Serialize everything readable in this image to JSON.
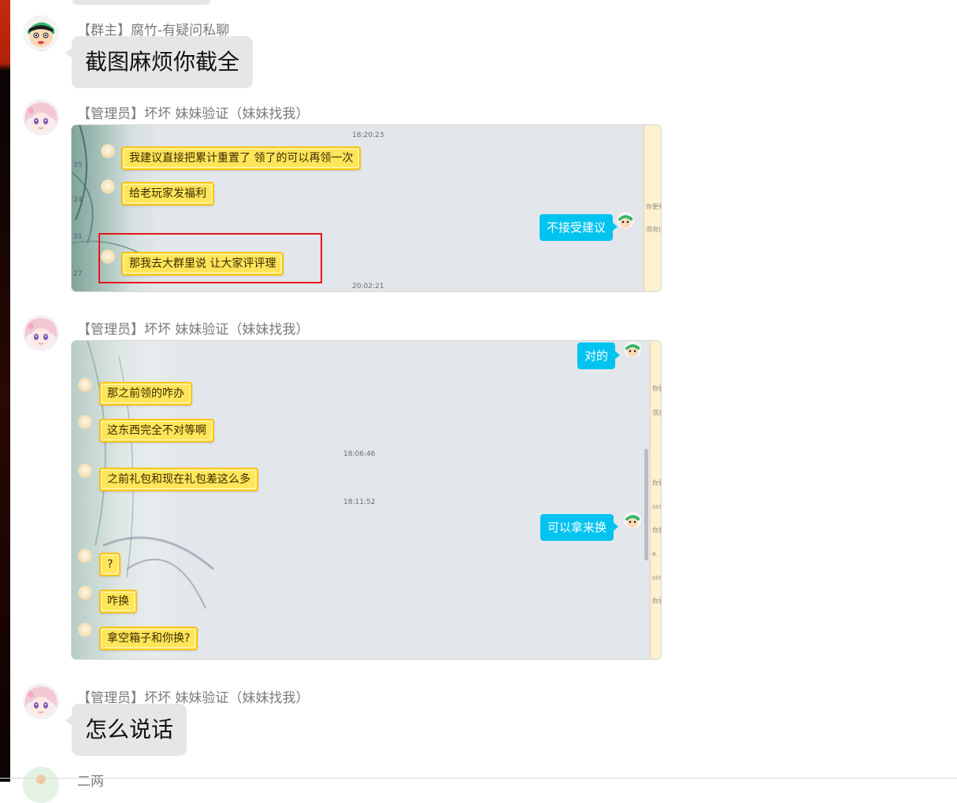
{
  "messages": [
    {
      "sender": "【群主】腐竹-有疑问私聊",
      "text": "截图麻烦你截全"
    },
    {
      "sender": "【管理员】坏坏 妹妹验证（妹妹找我）",
      "screenshot": {
        "times": [
          "18:20:23",
          "20:02:21"
        ],
        "left_bubbles": [
          "我建议直接把累计重置了 领了的可以再领一次",
          "给老玩家发福利",
          "那我去大群里说 让大家评评理"
        ],
        "right_bubbles": [
          "不接受建议"
        ],
        "side_numbers": [
          "35",
          "24",
          "31",
          "27"
        ],
        "right_panel_fragments": [
          "你更新",
          "须充值"
        ]
      }
    },
    {
      "sender": "【管理员】坏坏 妹妹验证（妹妹找我）",
      "screenshot": {
        "times": [
          "18:06:46",
          "18:11:52"
        ],
        "right_bubbles": [
          "对的",
          "可以拿来换"
        ],
        "left_bubbles": [
          "那之前领的咋办",
          "这东西完全不对等啊",
          "之前礼包和现在礼包差这么多",
          "?",
          "咋换",
          "拿空箱子和你换?"
        ],
        "right_panel_fragments": [
          "你要",
          "须充",
          "你要",
          "sss",
          "你要",
          "e.",
          "sss",
          "你要"
        ]
      }
    },
    {
      "sender": "【管理员】坏坏 妹妹验证（妹妹找我）",
      "text": "怎么说话"
    },
    {
      "sender": "二两"
    }
  ]
}
